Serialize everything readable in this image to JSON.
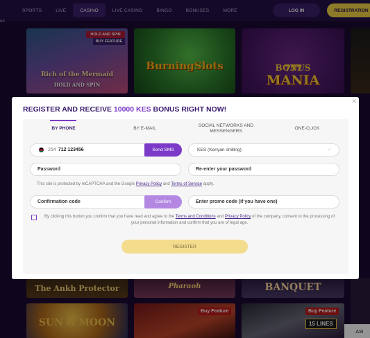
{
  "nav": {
    "items": [
      "SPORTS",
      "LIVE",
      "CASINO",
      "LIVE CASINO",
      "BINGO",
      "BONUSES",
      "MORE"
    ],
    "active": "CASINO",
    "login_label": "LOG IN",
    "register_label": "REGISTRATION"
  },
  "side_text": "es",
  "games": {
    "mermaid": {
      "hold_badge": "HOLD AND SPIN",
      "buy_badge": "BUY FEATURE",
      "title": "Rich of the Mermaid",
      "subtitle": "HOLD AND SPIN"
    },
    "burning": {
      "title": "BurningSlots"
    },
    "bonus_mania": {
      "big": "777",
      "title": "BONUS",
      "title2": "MANIA"
    },
    "ankh": {
      "title": "The Ankh Protector"
    },
    "pharaoh": {
      "title": "Pharaoh"
    },
    "banquet": {
      "title": "BANQUET"
    },
    "sun_moon": {
      "title": "SUN & MOON"
    },
    "buy_feature_1": "Buy Feature",
    "buy_feature_2": "Buy Feature",
    "lines": "15 LINES"
  },
  "corner_button": "ASI",
  "modal": {
    "title_prefix": "REGISTER AND RECEIVE ",
    "title_bonus": "10000 KES",
    "title_suffix": " BONUS RIGHT NOW!",
    "close": "×",
    "tabs": [
      "BY PHONE",
      "BY E-MAIL",
      "SOCIAL NETWORKS AND MESSENGERS",
      "ONE-CLICK"
    ],
    "phone": {
      "country_code": "254",
      "number": "712 123456",
      "send_sms": "Send SMS"
    },
    "currency": {
      "value": "KES (Kenyan shilling)"
    },
    "password_placeholder": "Password",
    "repassword_placeholder": "Re-enter your password",
    "captcha": {
      "prefix": "This site is protected by reCAPTCHA and the Google ",
      "privacy": "Privacy Policy",
      "and": " and ",
      "terms": "Terms of Service",
      "suffix": " apply."
    },
    "confirmation_placeholder": "Confirmation code",
    "confirm_label": "Confirm",
    "promo_placeholder": "Enter promo code (if you have one)",
    "terms": {
      "prefix": "By clicking this button you confirm that you have read and agree to the ",
      "terms_link": "Terms and Conditions",
      "and": " and ",
      "privacy_link": "Privacy Policy",
      "suffix": " of the company, consent to the processing of your personal information and confirm that you are of legal age."
    },
    "register_label": "REGISTER"
  },
  "colors": {
    "brand_purple": "#7b3ac8",
    "dark_purple": "#3a1c6e",
    "register_yellow": "#f5d547",
    "topbar_bg": "#241045"
  }
}
